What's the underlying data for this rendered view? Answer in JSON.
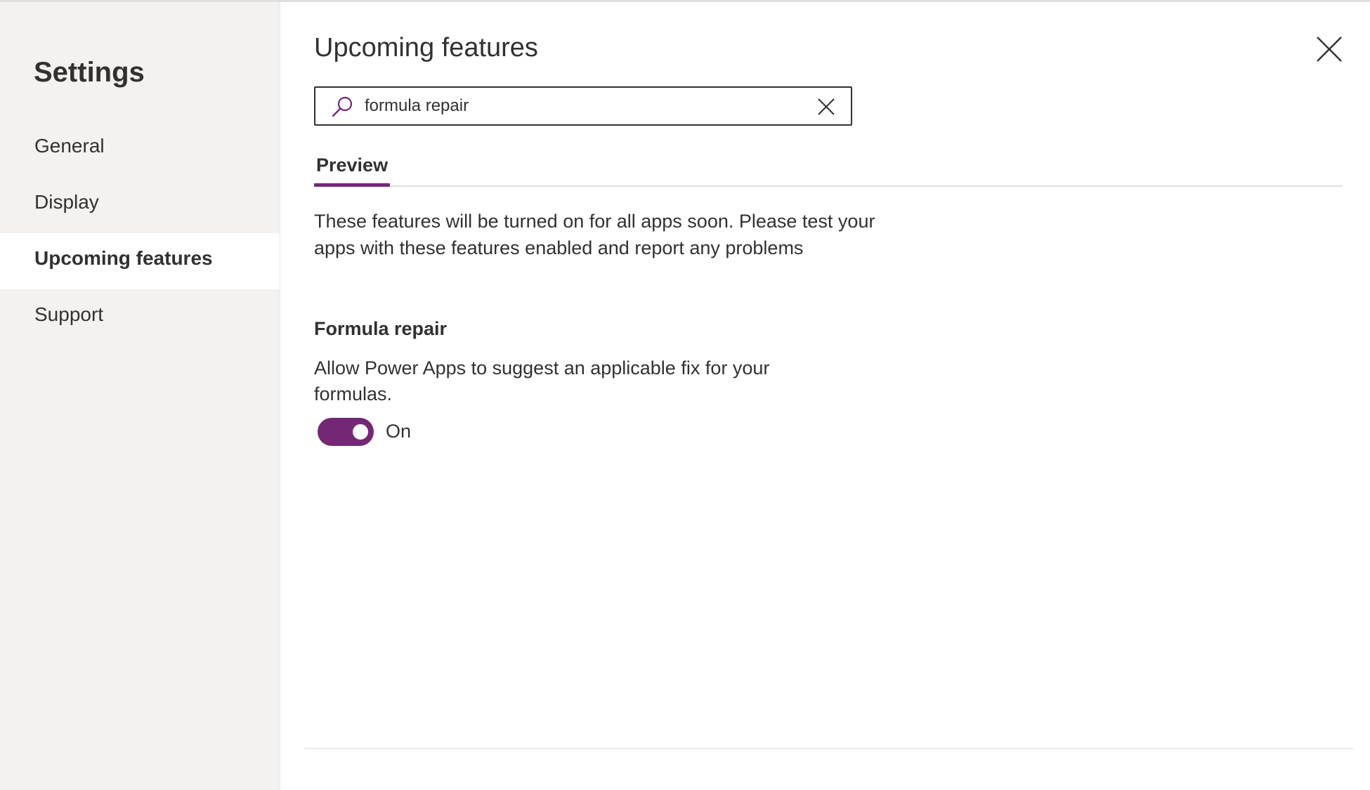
{
  "sidebar": {
    "title": "Settings",
    "items": [
      {
        "label": "General",
        "active": false
      },
      {
        "label": "Display",
        "active": false
      },
      {
        "label": "Upcoming features",
        "active": true
      },
      {
        "label": "Support",
        "active": false
      }
    ]
  },
  "main": {
    "title": "Upcoming features",
    "search": {
      "value": "formula repair"
    },
    "tabs": [
      {
        "label": "Preview",
        "selected": true
      }
    ],
    "description": "These features will be turned on for all apps soon. Please test your apps with these features enabled and report any problems",
    "features": [
      {
        "title": "Formula repair",
        "description": "Allow Power Apps to suggest an applicable fix for your formulas.",
        "toggle": {
          "state": true,
          "label": "On"
        }
      }
    ]
  },
  "icons": {
    "close": "close-icon",
    "search": "search-icon",
    "clear": "clear-icon"
  },
  "colors": {
    "accent": "#742774",
    "sidebar_bg": "#f3f2f1",
    "text": "#323130",
    "divider": "#e1dfdd"
  }
}
